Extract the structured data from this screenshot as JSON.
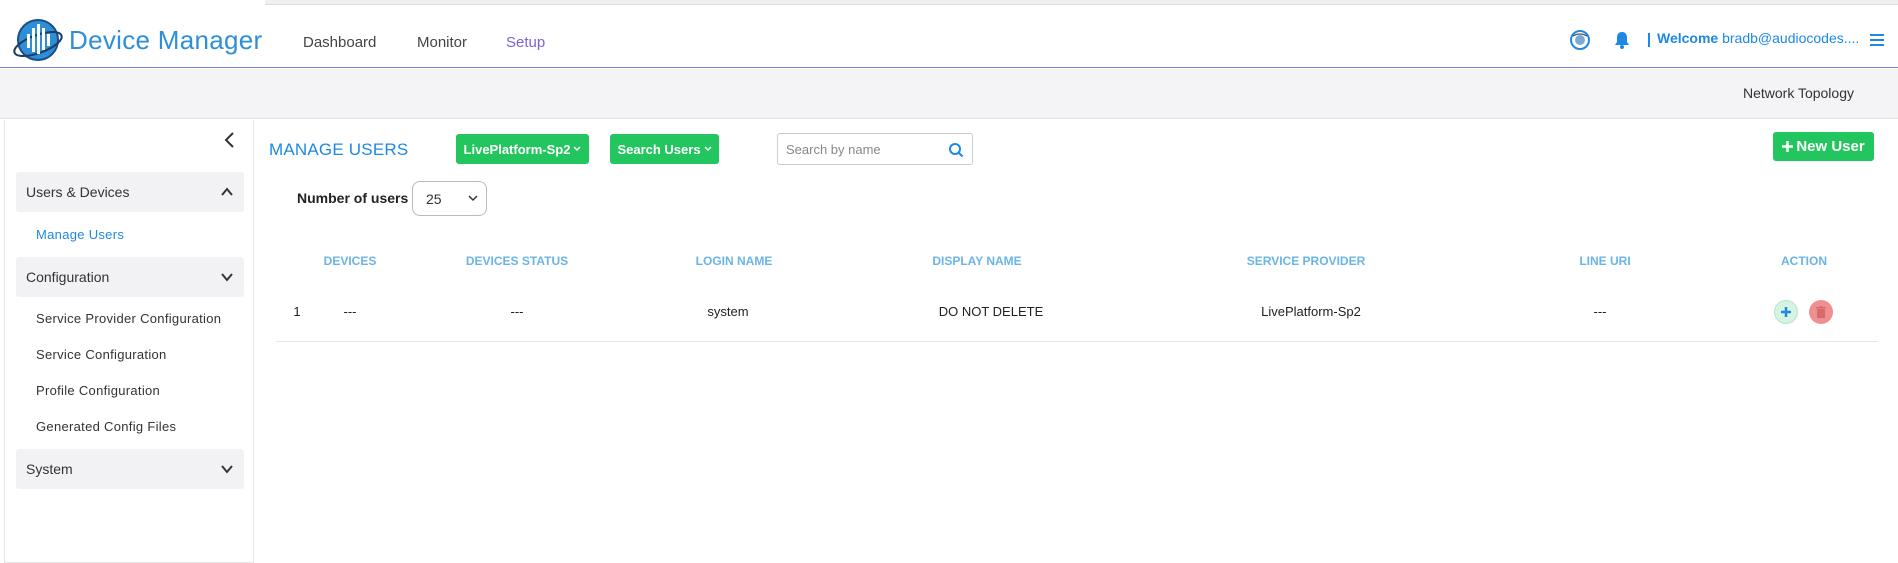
{
  "header": {
    "brand": "Device Manager",
    "nav": [
      "Dashboard",
      "Monitor",
      "Setup"
    ],
    "active_nav": "Setup",
    "welcome_label": "Welcome",
    "user": "bradb@audiocodes....",
    "icons": [
      "globe-icon",
      "bell-icon",
      "hamburger-menu-icon"
    ]
  },
  "subbar": {
    "link": "Network Topology"
  },
  "sidebar": {
    "sections": [
      {
        "label": "Users & Devices",
        "expanded": true,
        "items": [
          "Manage Users"
        ]
      },
      {
        "label": "Configuration",
        "expanded": false,
        "items": [
          "Service Provider Configuration",
          "Service Configuration",
          "Profile Configuration",
          "Generated Config Files"
        ]
      },
      {
        "label": "System",
        "expanded": false,
        "items": []
      }
    ],
    "active_item": "Manage Users"
  },
  "main": {
    "title": "MANAGE USERS",
    "tenant_button": "LivePlatform-Sp2",
    "search_users_button": "Search Users",
    "search_placeholder": "Search by name",
    "new_user_button": "New User",
    "number_of_users_label": "Number of users",
    "number_of_users_value": "25"
  },
  "table": {
    "columns": [
      "DEVICES",
      "DEVICES STATUS",
      "LOGIN NAME",
      "DISPLAY NAME",
      "SERVICE PROVIDER",
      "LINE URI",
      "ACTION"
    ],
    "rows": [
      {
        "index": "1",
        "devices": "---",
        "devices_status": "---",
        "login_name": "system",
        "display_name": "DO NOT DELETE",
        "service_provider": "LivePlatform-Sp2",
        "line_uri": "---"
      }
    ]
  },
  "colors": {
    "accent_blue": "#1e88e5",
    "green": "#22c55e",
    "nav_active": "#7b62d8",
    "delete_red": "#ef8f8f"
  }
}
